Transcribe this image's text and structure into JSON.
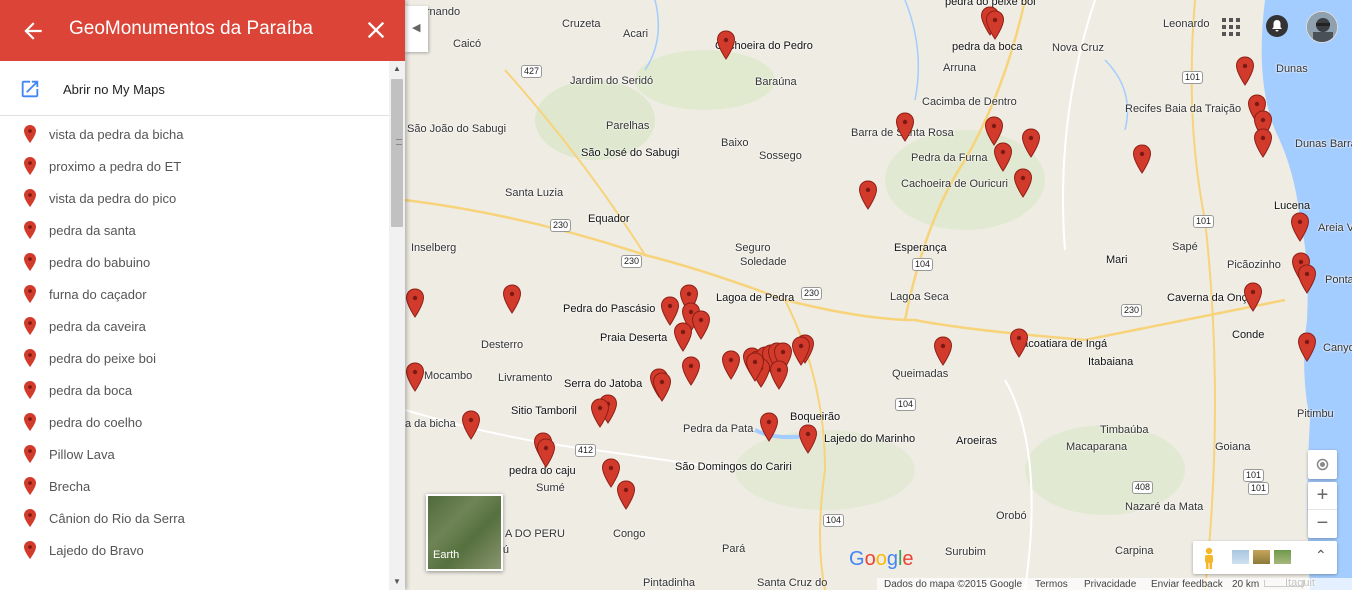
{
  "panel": {
    "title": "GeoMonumentos da Paraíba",
    "open_mymaps_label": "Abrir no My Maps",
    "items": [
      "vista da pedra da bicha",
      "proximo a pedra do ET",
      "vista da pedra do pico",
      "pedra da santa",
      "pedra do babuino",
      "furna do caçador",
      "pedra da caveira",
      "pedra do peixe boi",
      "pedra da boca",
      "pedra do coelho",
      "Pillow Lava",
      "Brecha",
      "Cânion do Rio da Serra",
      "Lajedo do Bravo"
    ]
  },
  "map": {
    "places": [
      "Fernando",
      "Cruzeta",
      "Acari",
      "Caicó",
      "Cachoeira do Pedro",
      "pedra do peixe boi",
      "pedra da boca",
      "Nova Cruz",
      "Leonardo",
      "Jardim do Seridó",
      "Arruna",
      "Baraúna",
      "São João do Sabugi",
      "Parelhas",
      "Cacimba de Dentro",
      "Dunas",
      "Recifes Baia da Traição",
      "Barra de Santa Rosa",
      "Baixo",
      "Sossego",
      "São José do Sabugi",
      "Pedra da Furna",
      "Dunas Barra de",
      "Cachoeira de Ouricuri",
      "Santa Luzia",
      "Equador",
      "Lucena",
      "Inselberg",
      "Seguro",
      "Soledade",
      "Esperança",
      "Mari",
      "Sapé",
      "Picãozinho",
      "Areia V",
      "Lagoa de Pedra",
      "Pedra do Pascásio",
      "Lagoa Seca",
      "Caverna da Onça",
      "Ponta",
      "Praia Deserta",
      "Desterro",
      "Itacoatiara de Ingá",
      "Conde",
      "Mocambo",
      "Livramento",
      "Serra do Jatoba",
      "Queimadas",
      "Itabaiana",
      "Canyo",
      "Sitio Tamboril",
      "Pitimbu",
      "a da bicha",
      "Pedra da Pata",
      "Boqueirão",
      "Lajedo do Marinho",
      "Aroeiras",
      "Timbaúba",
      "Macaparana",
      "Goiana",
      "pedra do caju",
      "São Domingos do Cariri",
      "Sumé",
      "A DO PERU",
      "Congo",
      "Orobó",
      "Nazaré da Mata",
      "Camalaú",
      "Pará",
      "Surubim",
      "Carpina",
      "Pintadinha",
      "Santa Cruz do",
      "Itaquit"
    ],
    "shields": [
      "427",
      "230",
      "230",
      "230",
      "104",
      "230",
      "104",
      "101",
      "101",
      "101",
      "412",
      "104",
      "408",
      "101"
    ],
    "pin_count": 60,
    "google_logo": "Google",
    "earth_label": "Earth",
    "footer": {
      "data": "Dados do mapa ©2015 Google",
      "terms": "Termos",
      "privacy": "Privacidade",
      "feedback": "Enviar feedback",
      "scale": "20 km"
    }
  },
  "colors": {
    "header": "#db4437",
    "pin": "#d23a2c",
    "map_bg": "#efece4",
    "water": "#a3ccff",
    "road": "#f7d37a"
  }
}
